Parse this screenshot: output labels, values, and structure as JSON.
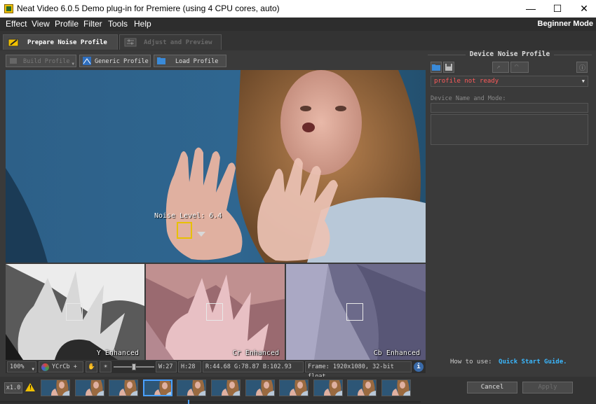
{
  "window": {
    "title": "Neat Video 6.0.5 Demo plug-in for Premiere (using 4 CPU cores, auto)",
    "minimize": "—",
    "maximize": "☐",
    "close": "✕"
  },
  "menu": {
    "items": [
      "Effect",
      "View",
      "Profile",
      "Filter",
      "Tools",
      "Help"
    ],
    "mode": "Beginner Mode"
  },
  "tabs": [
    {
      "label": "Prepare Noise Profile",
      "active": true
    },
    {
      "label": "Adjust and Preview",
      "active": false
    }
  ],
  "toolbar": {
    "build_profile": "Build Profile",
    "generic_profile": "Generic Profile",
    "load_profile": "Load Profile"
  },
  "viewer": {
    "noise_level_label": "Noise Level: 6.4",
    "subviews": [
      "Y Enhanced",
      "Cr Enhanced",
      "Cb Enhanced"
    ]
  },
  "statusbar": {
    "zoom": "100%",
    "colorspace": "YCrCb +",
    "width": "W:27",
    "height": "H:28",
    "rgb": "R:44.68  G:78.87  B:102.93",
    "frame": "Frame: 1920x1080, 32-bit float"
  },
  "device_panel": {
    "title": "Device Noise Profile",
    "profile_status": "profile not ready",
    "device_name_label": "Device Name and Mode:",
    "howto_prefix": "How to use:",
    "howto_link": "Quick  Start  Guide.",
    "colors": {
      "status": "#ff5a5a",
      "link": "#3ab8ff",
      "accent": "#4aa0ff"
    }
  },
  "bottom": {
    "zoom_factor": "x1.0",
    "thumbnail_count": 11,
    "selected_thumbnail": 3,
    "cancel": "Cancel",
    "apply": "Apply"
  }
}
